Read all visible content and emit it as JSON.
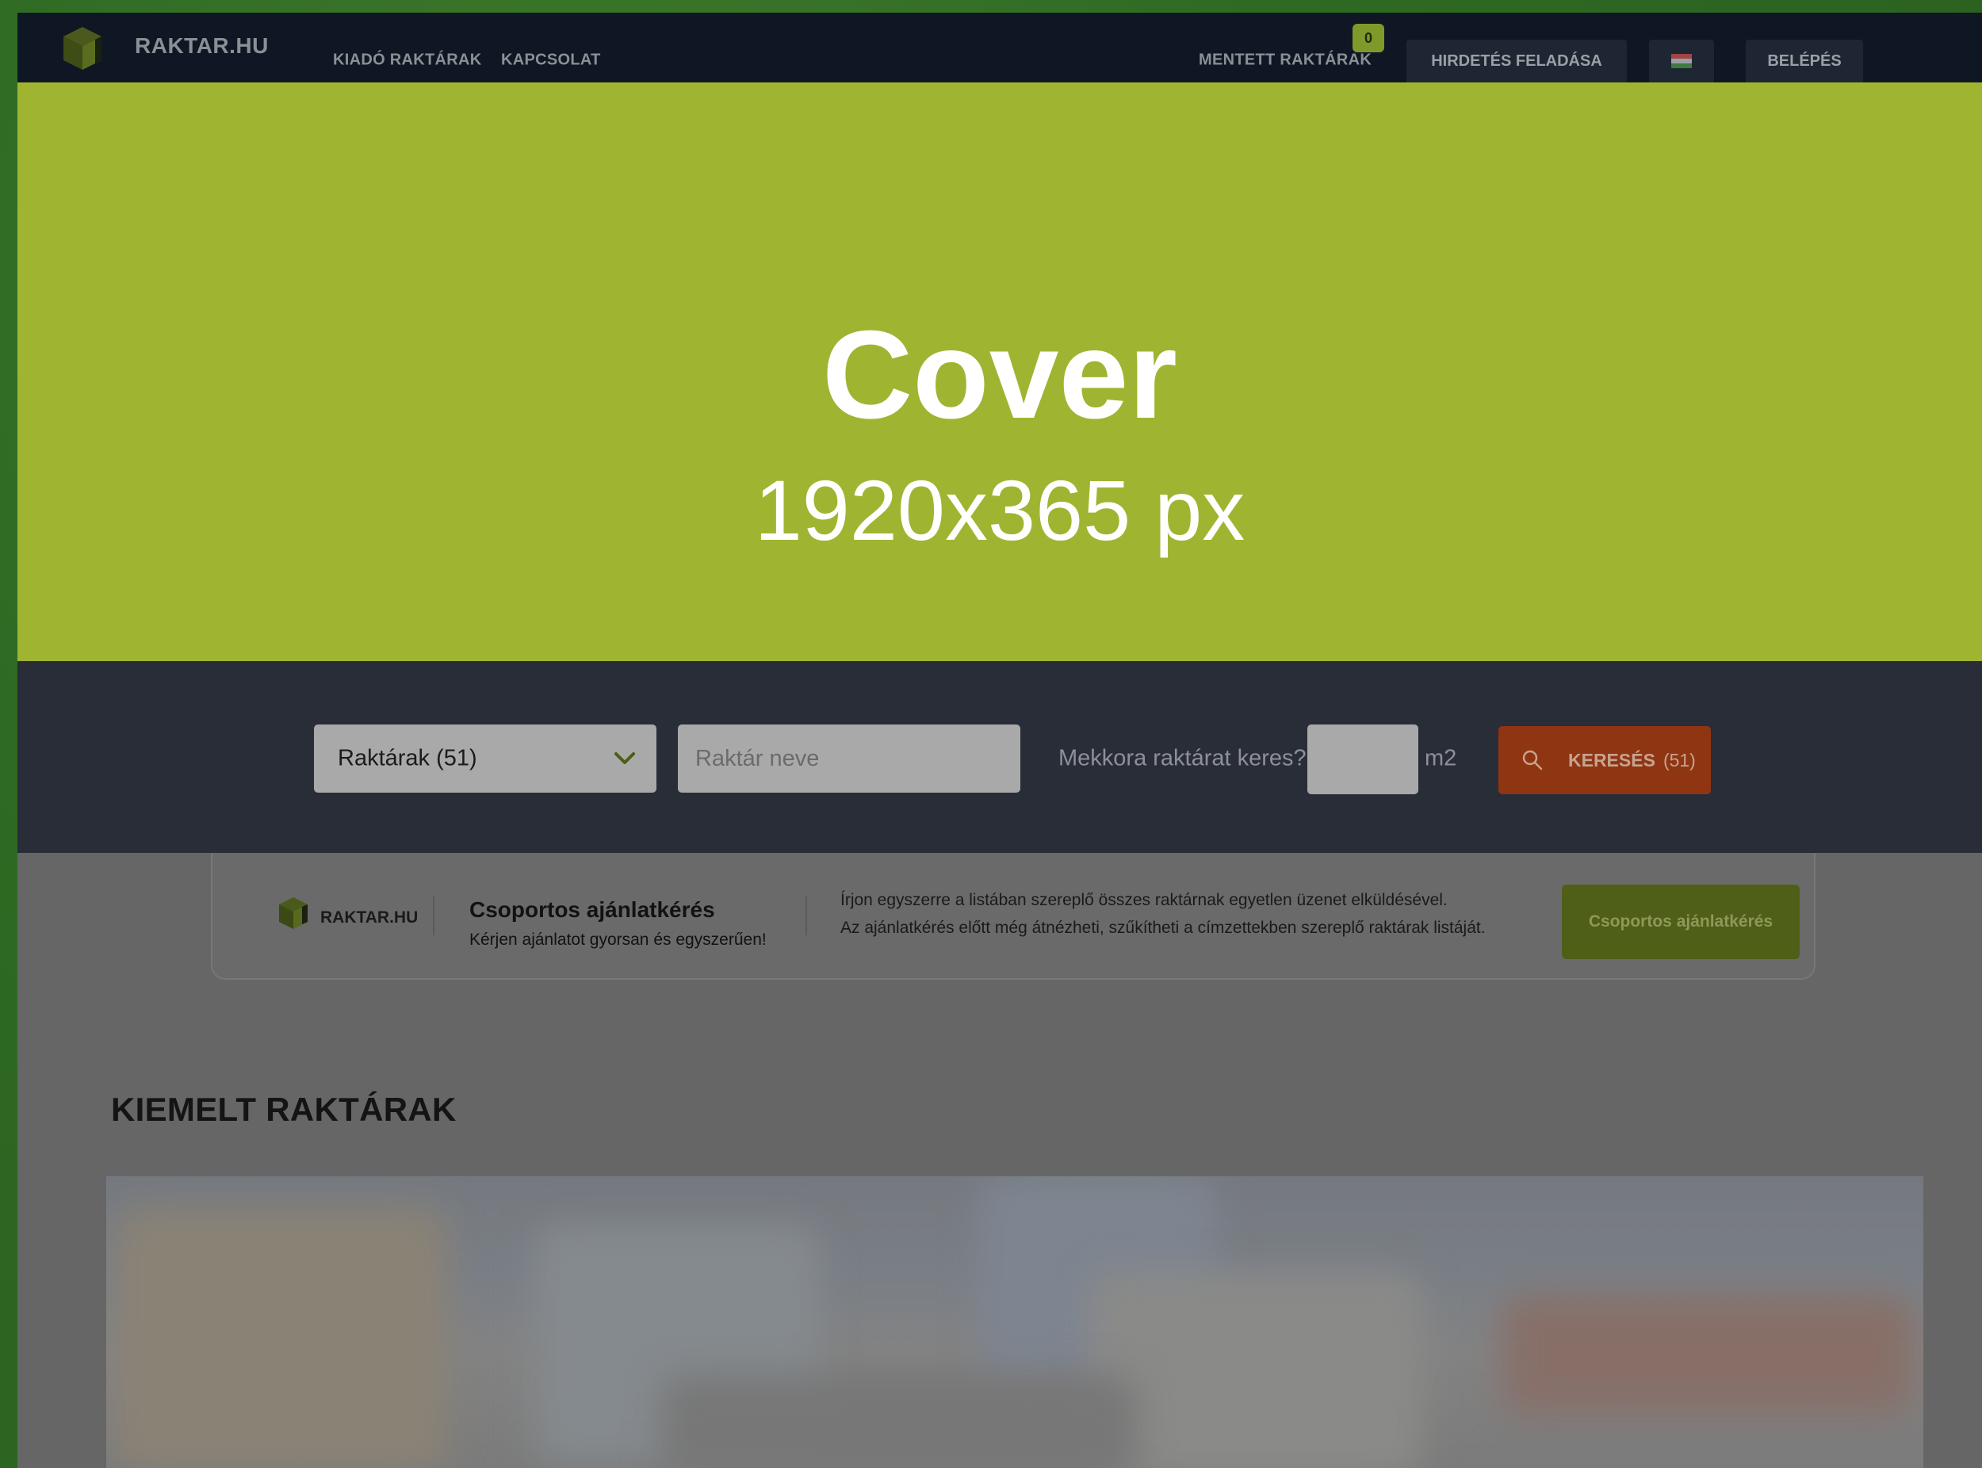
{
  "nav": {
    "brand": "RAKTAR.HU",
    "links": [
      "KIADÓ RAKTÁRAK",
      "KAPCSOLAT"
    ],
    "saved_label": "MENTETT RAKTÁRAK",
    "saved_count": "0",
    "post_ad": "HIRDETÉS FELADÁSA",
    "login": "BELÉPÉS",
    "language_icon": "hungarian-flag-icon"
  },
  "cover": {
    "title": "Cover",
    "size_text": "1920x365 px"
  },
  "search": {
    "type_select": "Raktárak (51)",
    "name_placeholder": "Raktár neve",
    "size_question": "Mekkora raktárat keres?",
    "size_unit": "m2",
    "button_label": "KERESÉS",
    "button_count": "(51)"
  },
  "group_offer": {
    "brand": "RAKTAR.HU",
    "title": "Csoportos ajánlatkérés",
    "subtitle": "Kérjen ajánlatot gyorsan és egyszerűen!",
    "desc_line1": "Írjon egyszerre a listában szereplő összes raktárnak egyetlen üzenet elküldésével.",
    "desc_line2": "Az ajánlatkérés előtt még átnézheti, szűkítheti a címzettekben szereplő raktárak listáját.",
    "button": "Csoportos ajánlatkérés"
  },
  "featured": {
    "title": "KIEMELT RAKTÁRAK"
  },
  "colors": {
    "nav_bg": "#0f1724",
    "cover_bg": "#9fb531",
    "search_bg": "#282d37",
    "accent_green": "#7f9a2a",
    "search_button": "#8f3512",
    "overlay_body": "#666666"
  }
}
